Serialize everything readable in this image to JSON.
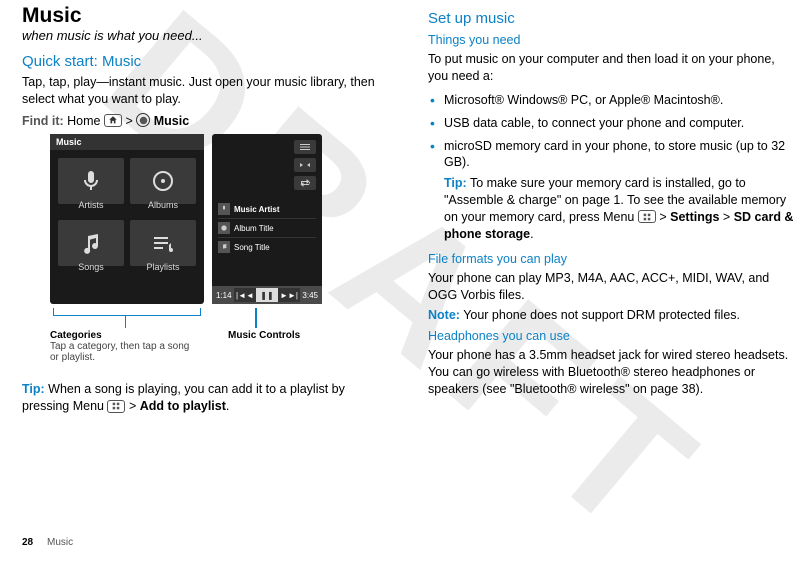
{
  "watermark": "DRAFT",
  "left": {
    "title": "Music",
    "subtitle": "when music is what you need...",
    "quick_start_h": "Quick start: Music",
    "quick_start_body": "Tap, tap, play—instant music. Just open your music library, then select what you want to play.",
    "findit_label": "Find it:",
    "findit_home": "Home",
    "findit_gt": ">",
    "findit_music": "Music",
    "phone": {
      "header": "Music",
      "tiles": [
        "Artists",
        "Albums",
        "Songs",
        "Playlists"
      ],
      "np": {
        "artist": "Music Artist",
        "album": "Album Title",
        "song": "Song Title",
        "time_left": "1:14",
        "time_right": "3:45"
      }
    },
    "callouts": {
      "cat_title": "Categories",
      "cat_desc": "Tap a category, then tap a song or playlist.",
      "mc_title": "Music Controls"
    },
    "tip_label": "Tip:",
    "tip_body_1": "When a song is playing, you can add it to a playlist by pressing Menu",
    "tip_gt": ">",
    "tip_bold": "Add to playlist",
    "tip_end": "."
  },
  "right": {
    "setup_h": "Set up music",
    "things_h": "Things you need",
    "things_intro": "To put music on your computer and then load it on your phone, you need a:",
    "bullets": [
      "Microsoft® Windows® PC, or Apple® Macintosh®.",
      "USB data cable, to connect your phone and computer.",
      "microSD memory card in your phone, to store music (up to 32 GB)."
    ],
    "sd_tip_label": "Tip:",
    "sd_tip_1": "To make sure your memory card is installed, go to \"Assemble & charge\" on page 1. To see the available memory on your memory card, press Menu",
    "sd_tip_gt1": ">",
    "sd_tip_settings": "Settings",
    "sd_tip_gt2": ">",
    "sd_tip_storage": "SD card & phone storage",
    "sd_tip_end": ".",
    "formats_h": "File formats you can play",
    "formats_body": "Your phone can play MP3, M4A, AAC, ACC+, MIDI, WAV, and OGG Vorbis files.",
    "note_label": "Note:",
    "note_body": "Your phone does not support DRM protected files.",
    "head_h": "Headphones you can use",
    "head_body": "Your phone has a 3.5mm headset jack for wired stereo headsets. You can go wireless with Bluetooth® stereo headphones or speakers (see \"Bluetooth® wireless\" on page 38)."
  },
  "footer": {
    "page": "28",
    "section": "Music"
  }
}
